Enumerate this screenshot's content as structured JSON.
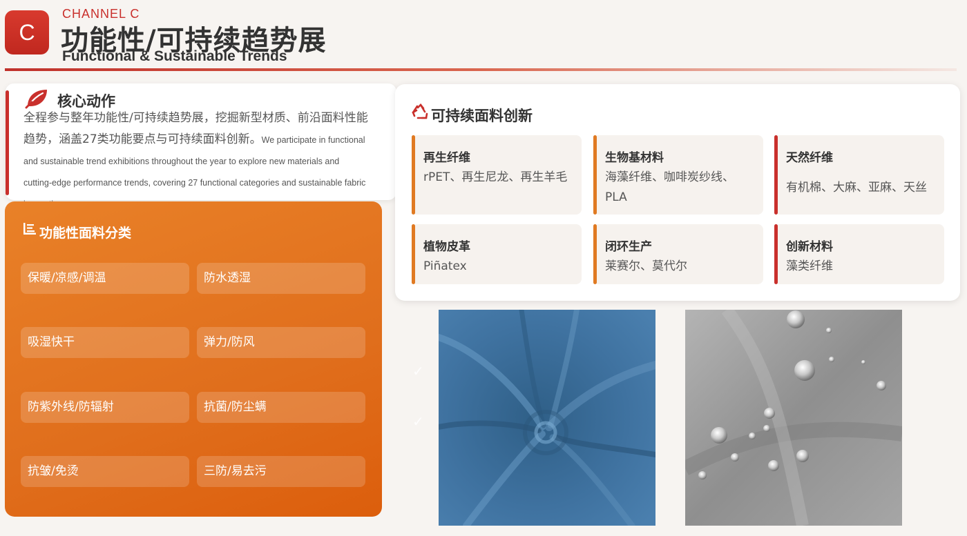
{
  "header": {
    "logo_letter": "C",
    "channel": "CHANNEL C",
    "title_cn": "功能性/可持续趋势展",
    "title_en": "Functional & Sustainable Trends"
  },
  "core": {
    "icon": "leaf-icon",
    "title": "核心动作",
    "text_cn": "全程参与整年功能性/可持续趋势展，挖掘新型材质、前沿面料性能趋势，涵盖27类功能要点与可持续面料创新。",
    "text_en": "We participate in functional and sustainable trend exhibitions throughout the year to explore new materials and cutting-edge performance trends, covering 27 functional categories and sustainable fabric innovations."
  },
  "functional": {
    "icon": "list-icon",
    "title": "功能性面料分类",
    "items": [
      "保暖/凉感/调温",
      "防水透湿",
      "吸湿快干",
      "弹力/防风",
      "防紫外线/防辐射",
      "抗菌/防尘螨",
      "抗皱/免烫",
      "三防/易去污"
    ]
  },
  "sustainable": {
    "icon": "recycle-icon",
    "title": "可持续面料创新",
    "items": [
      {
        "name": "再生纤维",
        "desc": "rPET、再生尼龙、再生羊毛",
        "color": "#e07a22"
      },
      {
        "name": "生物基材料",
        "desc": "海藻纤维、咖啡炭纱线、PLA",
        "color": "#e07a22"
      },
      {
        "name": "天然纤维",
        "desc": "有机棉、大麻、亚麻、天丝",
        "color": "#c9302c"
      },
      {
        "name": "植物皮革",
        "desc": "Piñatex",
        "color": "#e07a22"
      },
      {
        "name": "闭环生产",
        "desc": "莱赛尔、莫代尔",
        "color": "#e07a22"
      },
      {
        "name": "创新材料",
        "desc": "藻类纤维",
        "color": "#c9302c"
      }
    ]
  },
  "checks": [
    "✓",
    "✓"
  ],
  "colors": {
    "brand_red": "#c9302c",
    "orange": "#e07a22",
    "panel_orange": "#e47620",
    "fabric_blue": "#3d6e96",
    "fabric_gray": "#9a9a9a"
  }
}
